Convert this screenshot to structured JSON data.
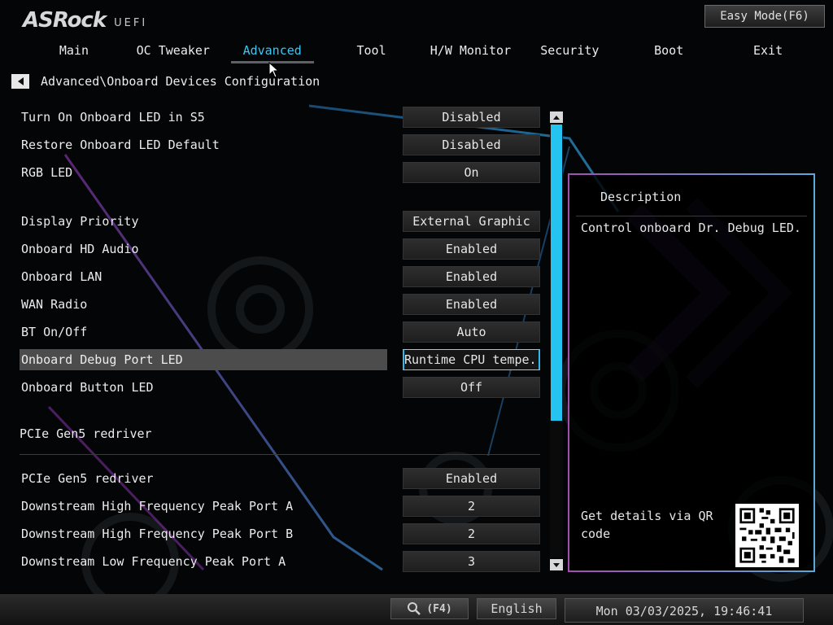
{
  "header": {
    "brand": "ASRock",
    "brand_sub": "UEFI",
    "easy_mode_label": "Easy Mode(F6)"
  },
  "tabs": [
    {
      "label": "Main"
    },
    {
      "label": "OC Tweaker"
    },
    {
      "label": "Advanced",
      "active": true
    },
    {
      "label": "Tool"
    },
    {
      "label": "H/W Monitor"
    },
    {
      "label": "Security"
    },
    {
      "label": "Boot"
    },
    {
      "label": "Exit"
    }
  ],
  "breadcrumb": "Advanced\\Onboard Devices Configuration",
  "settings": [
    {
      "label": "Turn On Onboard LED in S5",
      "value": "Disabled"
    },
    {
      "label": "Restore Onboard LED Default",
      "value": "Disabled"
    },
    {
      "label": "RGB LED",
      "value": "On"
    },
    {
      "label": "Display Priority",
      "value": "External Graphic"
    },
    {
      "label": "Onboard HD Audio",
      "value": "Enabled"
    },
    {
      "label": "Onboard LAN",
      "value": "Enabled"
    },
    {
      "label": "WAN Radio",
      "value": "Enabled"
    },
    {
      "label": "BT On/Off",
      "value": "Auto"
    },
    {
      "label": "Onboard Debug Port LED",
      "value": "Runtime CPU tempe...",
      "selected": true
    },
    {
      "label": "Onboard Button LED",
      "value": "Off"
    },
    {
      "label": "PCIe Gen5 redriver",
      "value": "Enabled"
    },
    {
      "label": "Downstream High Frequency Peak Port A",
      "value": "2"
    },
    {
      "label": "Downstream High Frequency Peak Port B",
      "value": "2"
    },
    {
      "label": "Downstream Low Frequency Peak Port A",
      "value": "3"
    }
  ],
  "section_heading": "PCIe Gen5 redriver",
  "description": {
    "title": "Description",
    "text": "Control onboard Dr. Debug LED.",
    "qr_text": "Get details via QR code"
  },
  "footer": {
    "search_key": "(F4)",
    "language": "English",
    "datetime": "Mon 03/03/2025, 19:46:41"
  },
  "colors": {
    "accent": "#3ec6f2",
    "scrollbar": "#25c3f0",
    "highlight_row": "#4c4c4c"
  },
  "icons": [
    "back-arrow-icon",
    "search-icon",
    "mouse-cursor-icon",
    "qr-code-icon",
    "scroll-up-icon",
    "scroll-down-icon"
  ]
}
